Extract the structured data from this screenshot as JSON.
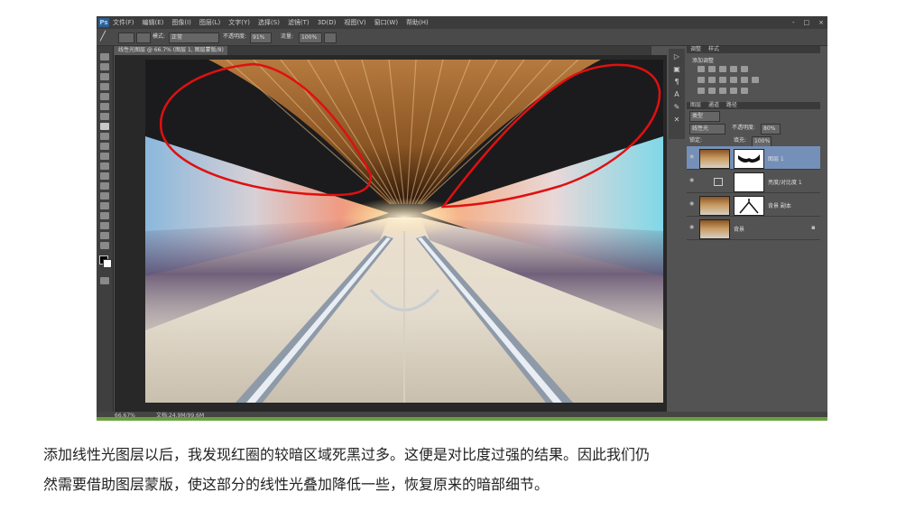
{
  "app": {
    "logo": "Ps",
    "menus": [
      "文件(F)",
      "编辑(E)",
      "图像(I)",
      "图层(L)",
      "文字(Y)",
      "选择(S)",
      "滤镜(T)",
      "3D(D)",
      "视图(V)",
      "窗口(W)",
      "帮助(H)"
    ],
    "window_controls": [
      "-",
      "□",
      "×"
    ]
  },
  "options_bar": {
    "mode_label": "模式:",
    "mode_value": "正常",
    "opacity_label": "不透明度:",
    "opacity_value": "91%",
    "flow_label": "流量:",
    "flow_value": "100%"
  },
  "document": {
    "tab_label": "线性光图层 @ 66.7% (图层 1, 图层蒙版/8)",
    "zoom": "66.67%",
    "doc_info": "文档:24.9M/99.6M"
  },
  "panels": {
    "adjustments_tab": "调整",
    "styles_tab": "样式",
    "adjustments_title": "添加调整",
    "layers_tab": "图层",
    "channels_tab": "通道",
    "paths_tab": "路径",
    "kind_label": "类型",
    "blend_mode": "线性光",
    "opacity_label": "不透明度:",
    "opacity_value": "80%",
    "lock_label": "锁定:",
    "fill_label": "填充:",
    "fill_value": "100%",
    "layers": [
      {
        "name": "图层 1"
      },
      {
        "name": "亮度/对比度 1"
      },
      {
        "name": "背景 副本"
      },
      {
        "name": "背景"
      }
    ]
  },
  "caption": {
    "line1": "添加线性光图层以后，我发现红圈的较暗区域死黑过多。这便是对比度过强的结果。因此我们仍",
    "line2": "然需要借助图层蒙版，使这部分的线性光叠加降低一些，恢复原来的暗部细节。"
  },
  "colors": {
    "annotation_red": "#e01010",
    "ps_chrome": "#535353",
    "selected_layer": "#7590b8"
  }
}
